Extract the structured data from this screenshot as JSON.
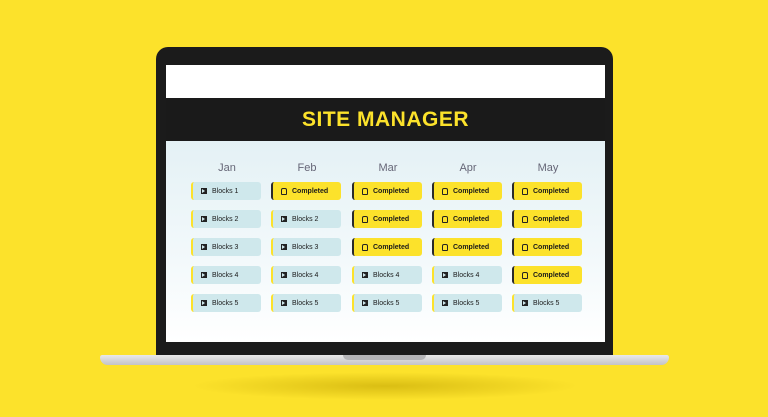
{
  "header": {
    "title": "SITE MANAGER"
  },
  "colors": {
    "background": "#FCE22B",
    "accent": "#FCE22B",
    "header_bg": "#1a1a1a",
    "blocks_bg": "#cfe8ec"
  },
  "months": [
    {
      "name": "Jan",
      "cells": [
        {
          "status": "blocks",
          "label": "Blocks 1",
          "icon": "play-icon"
        },
        {
          "status": "blocks",
          "label": "Blocks 2",
          "icon": "play-icon"
        },
        {
          "status": "blocks",
          "label": "Blocks 3",
          "icon": "play-icon"
        },
        {
          "status": "blocks",
          "label": "Blocks 4",
          "icon": "play-icon"
        },
        {
          "status": "blocks",
          "label": "Blocks 5",
          "icon": "play-icon"
        }
      ]
    },
    {
      "name": "Feb",
      "cells": [
        {
          "status": "completed",
          "label": "Completed",
          "icon": "helmet-icon"
        },
        {
          "status": "blocks",
          "label": "Blocks 2",
          "icon": "play-icon"
        },
        {
          "status": "blocks",
          "label": "Blocks 3",
          "icon": "play-icon"
        },
        {
          "status": "blocks",
          "label": "Blocks 4",
          "icon": "play-icon"
        },
        {
          "status": "blocks",
          "label": "Blocks 5",
          "icon": "play-icon"
        }
      ]
    },
    {
      "name": "Mar",
      "cells": [
        {
          "status": "completed",
          "label": "Completed",
          "icon": "helmet-icon"
        },
        {
          "status": "completed",
          "label": "Completed",
          "icon": "helmet-icon"
        },
        {
          "status": "completed",
          "label": "Completed",
          "icon": "helmet-icon"
        },
        {
          "status": "blocks",
          "label": "Blocks 4",
          "icon": "play-icon"
        },
        {
          "status": "blocks",
          "label": "Blocks 5",
          "icon": "play-icon"
        }
      ]
    },
    {
      "name": "Apr",
      "cells": [
        {
          "status": "completed",
          "label": "Completed",
          "icon": "helmet-icon"
        },
        {
          "status": "completed",
          "label": "Completed",
          "icon": "helmet-icon"
        },
        {
          "status": "completed",
          "label": "Completed",
          "icon": "helmet-icon"
        },
        {
          "status": "blocks",
          "label": "Blocks 4",
          "icon": "play-icon"
        },
        {
          "status": "blocks",
          "label": "Blocks 5",
          "icon": "play-icon"
        }
      ]
    },
    {
      "name": "May",
      "cells": [
        {
          "status": "completed",
          "label": "Completed",
          "icon": "helmet-icon"
        },
        {
          "status": "completed",
          "label": "Completed",
          "icon": "helmet-icon"
        },
        {
          "status": "completed",
          "label": "Completed",
          "icon": "helmet-icon"
        },
        {
          "status": "completed",
          "label": "Completed",
          "icon": "helmet-icon"
        },
        {
          "status": "blocks",
          "label": "Blocks 5",
          "icon": "play-icon"
        }
      ]
    }
  ]
}
